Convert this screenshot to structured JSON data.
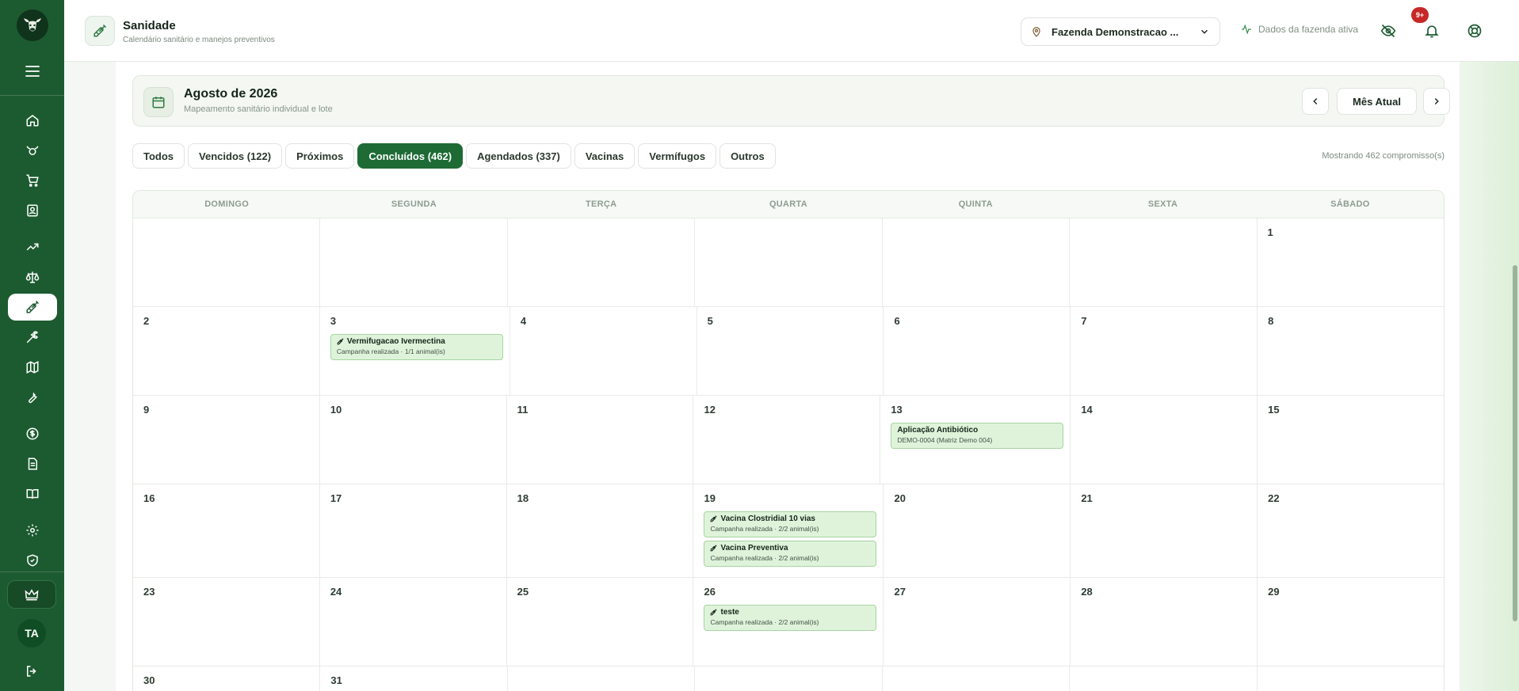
{
  "header": {
    "title": "Sanidade",
    "subtitle": "Calendário sanitário e manejos preventivos",
    "farm_select": "Fazenda Demonstracao ...",
    "farm_active": "Dados da fazenda ativa",
    "notification_badge": "9+"
  },
  "sidebar": {
    "avatar_initials": "TA",
    "items": [
      {
        "icon": "home-icon"
      },
      {
        "icon": "cattle-icon"
      },
      {
        "icon": "cart-icon"
      },
      {
        "icon": "contact-card-icon"
      },
      {
        "icon": "trending-up-icon"
      },
      {
        "icon": "scale-icon"
      },
      {
        "icon": "syringe-icon",
        "active": true
      },
      {
        "icon": "wheat-icon"
      },
      {
        "icon": "map-icon"
      },
      {
        "icon": "wrench-icon"
      },
      {
        "icon": "dollar-icon"
      },
      {
        "icon": "document-icon"
      },
      {
        "icon": "book-icon"
      },
      {
        "icon": "settings-icon"
      },
      {
        "icon": "shield-icon"
      }
    ]
  },
  "month": {
    "title": "Agosto de 2026",
    "subtitle": "Mapeamento sanitário individual e lote",
    "current_button": "Mês Atual"
  },
  "tabs": [
    {
      "label": "Todos",
      "active": false
    },
    {
      "label": "Vencidos (122)",
      "active": false
    },
    {
      "label": "Próximos",
      "active": false
    },
    {
      "label": "Concluídos (462)",
      "active": true
    },
    {
      "label": "Agendados (337)",
      "active": false
    },
    {
      "label": "Vacinas",
      "active": false
    },
    {
      "label": "Vermífugos",
      "active": false
    },
    {
      "label": "Outros",
      "active": false
    }
  ],
  "showing": "Mostrando 462 compromisso(s)",
  "calendar": {
    "weekdays": [
      "DOMINGO",
      "SEGUNDA",
      "TERÇA",
      "QUARTA",
      "QUINTA",
      "SEXTA",
      "SÁBADO"
    ],
    "weeks": [
      [
        null,
        null,
        null,
        null,
        null,
        null,
        {
          "day": "1",
          "events": []
        }
      ],
      [
        {
          "day": "2",
          "events": []
        },
        {
          "day": "3",
          "events": [
            {
              "title": "Vermifugacao Ivermectina",
              "sub": "Campanha realizada · 1/1 animal(is)",
              "icon": true
            }
          ]
        },
        {
          "day": "4",
          "events": []
        },
        {
          "day": "5",
          "events": []
        },
        {
          "day": "6",
          "events": []
        },
        {
          "day": "7",
          "events": []
        },
        {
          "day": "8",
          "events": []
        }
      ],
      [
        {
          "day": "9",
          "events": []
        },
        {
          "day": "10",
          "events": []
        },
        {
          "day": "11",
          "events": []
        },
        {
          "day": "12",
          "events": []
        },
        {
          "day": "13",
          "events": [
            {
              "title": "Aplicação Antibiótico",
              "sub": "DEMO-0004 (Matriz Demo 004)",
              "icon": false
            }
          ]
        },
        {
          "day": "14",
          "events": []
        },
        {
          "day": "15",
          "events": []
        }
      ],
      [
        {
          "day": "16",
          "events": []
        },
        {
          "day": "17",
          "events": []
        },
        {
          "day": "18",
          "events": []
        },
        {
          "day": "19",
          "events": [
            {
              "title": "Vacina Clostridial 10 vias",
              "sub": "Campanha realizada · 2/2 animal(is)",
              "icon": true
            },
            {
              "title": "Vacina Preventiva",
              "sub": "Campanha realizada · 2/2 animal(is)",
              "icon": true
            }
          ]
        },
        {
          "day": "20",
          "events": []
        },
        {
          "day": "21",
          "events": []
        },
        {
          "day": "22",
          "events": []
        }
      ],
      [
        {
          "day": "23",
          "events": []
        },
        {
          "day": "24",
          "events": []
        },
        {
          "day": "25",
          "events": []
        },
        {
          "day": "26",
          "events": [
            {
              "title": "teste",
              "sub": "Campanha realizada · 2/2 animal(is)",
              "icon": true
            }
          ]
        },
        {
          "day": "27",
          "events": []
        },
        {
          "day": "28",
          "events": []
        },
        {
          "day": "29",
          "events": []
        }
      ],
      [
        {
          "day": "30",
          "events": []
        },
        {
          "day": "31",
          "events": []
        },
        null,
        null,
        null,
        null,
        null
      ]
    ]
  },
  "colors": {
    "brand": "#1c5b30",
    "tab_active": "#1e6b35",
    "event_bg": "#dff3da",
    "badge": "#c62828"
  }
}
